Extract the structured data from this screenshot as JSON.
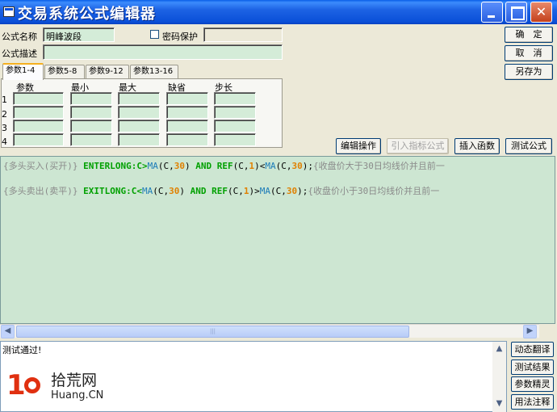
{
  "window": {
    "title": "交易系统公式编辑器"
  },
  "form": {
    "name_label": "公式名称",
    "name_value": "明峰波段",
    "password_label": "密码保护",
    "password_value": "",
    "desc_label": "公式描述",
    "desc_value": ""
  },
  "buttons": {
    "ok": "确　定",
    "cancel": "取　消",
    "save_as": "另存为",
    "edit_ops": "编辑操作",
    "import_formula": "引入指标公式",
    "insert_func": "插入函数",
    "test_formula": "测试公式"
  },
  "tabs": [
    "参数1-4",
    "参数5-8",
    "参数9-12",
    "参数13-16"
  ],
  "param_table": {
    "headers": [
      "参数",
      "最小",
      "最大",
      "缺省",
      "步长"
    ],
    "rows": [
      "1",
      "2",
      "3",
      "4"
    ]
  },
  "code": {
    "line1": {
      "c1": "{多头买入(买开)} ",
      "kw1": "ENTERLONG:C>",
      "f1": "MA",
      "p1": "(C,",
      "n1": "30",
      "p2": ") ",
      "and": "AND",
      "ref": " REF",
      "p3": "(C,",
      "n2": "1",
      "p4": ")<",
      "f2": "MA",
      "p5": "(C,",
      "n3": "30",
      "p6": ");",
      "c2": "{收盘价大于30日均线价并且前一"
    },
    "line2": {
      "c1": "{多头卖出(卖平)} ",
      "kw1": "EXITLONG:C<",
      "f1": "MA",
      "p1": "(C,",
      "n1": "30",
      "p2": ") ",
      "and": "AND",
      "ref": " REF",
      "p3": "(C,",
      "n2": "1",
      "p4": ")>",
      "f2": "MA",
      "p5": "(C,",
      "n3": "30",
      "p6": ");",
      "c2": "{收盘价小于30日均线价并且前一"
    }
  },
  "output": {
    "text": "测试通过!"
  },
  "side_buttons": [
    "动态翻译",
    "测试结果",
    "参数精灵",
    "用法注释"
  ],
  "watermark": {
    "num": "1",
    "cn": "拾荒网",
    "en": "Huang.CN"
  }
}
